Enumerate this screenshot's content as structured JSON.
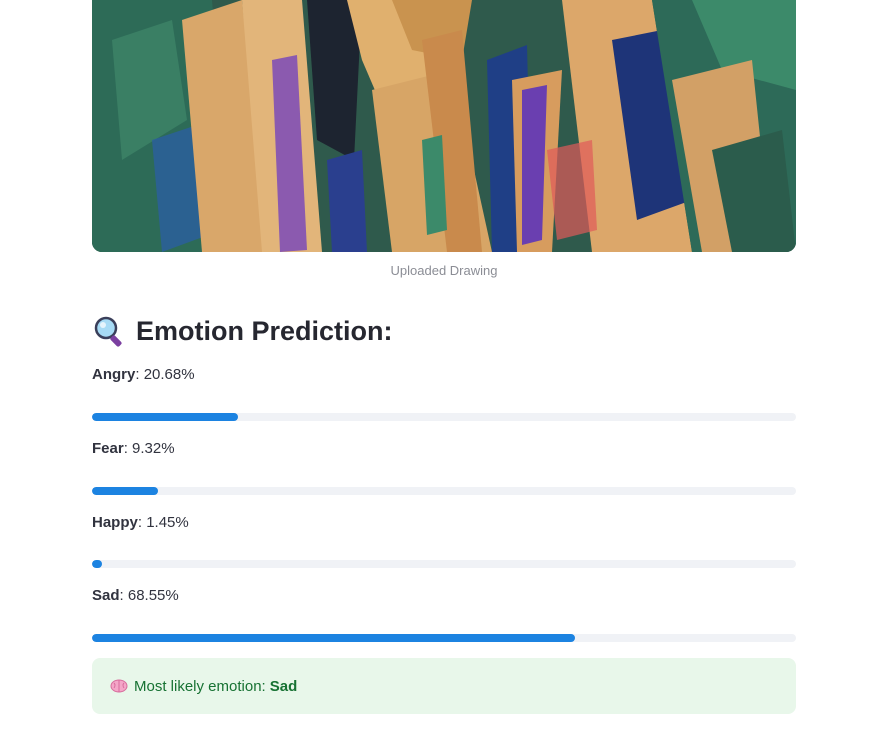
{
  "image": {
    "caption": "Uploaded Drawing",
    "alt": "uploaded drawing"
  },
  "heading": {
    "icon": "magnifier-icon",
    "text": "Emotion Prediction:"
  },
  "predictions": [
    {
      "label": "Angry",
      "percent_text": "20.68%",
      "value": 0.2068
    },
    {
      "label": "Fear",
      "percent_text": "9.32%",
      "value": 0.0932
    },
    {
      "label": "Happy",
      "percent_text": "1.45%",
      "value": 0.0145
    },
    {
      "label": "Sad",
      "percent_text": "68.55%",
      "value": 0.6855
    }
  ],
  "result": {
    "icon": "brain-icon",
    "prefix": "Most likely emotion:",
    "emotion": "Sad"
  },
  "colors": {
    "progress_fill": "#1c83e1",
    "progress_track": "#f0f2f6",
    "success_bg": "#e8f7ea",
    "success_text": "#177233"
  }
}
